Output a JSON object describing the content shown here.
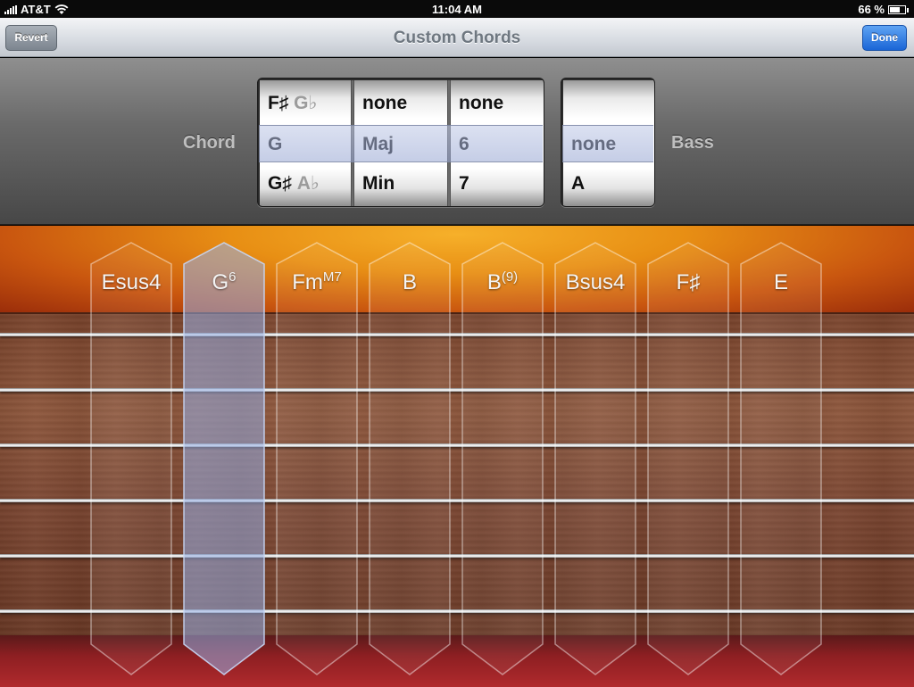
{
  "status_bar": {
    "carrier": "AT&T",
    "time": "11:04 AM",
    "battery_percent": "66 %",
    "battery_level": 0.66
  },
  "nav": {
    "title": "Custom Chords",
    "revert_label": "Revert",
    "done_label": "Done"
  },
  "picker": {
    "chord_label": "Chord",
    "bass_label": "Bass",
    "root_wheel": {
      "top": {
        "main": "F♯",
        "alt": "G♭"
      },
      "selected": {
        "main": "G",
        "alt": ""
      },
      "bottom": {
        "main": "G♯",
        "alt": "A♭"
      }
    },
    "quality_wheel": {
      "top": "none",
      "selected": "Maj",
      "bottom": "Min"
    },
    "extension_wheel": {
      "top": "none",
      "selected": "6",
      "bottom": "7"
    },
    "bass_wheel": {
      "top": "",
      "selected": "none",
      "bottom": "A"
    }
  },
  "chord_strips": [
    {
      "root": "Esus4",
      "sup": "",
      "selected": false
    },
    {
      "root": "G",
      "sup": "6",
      "selected": true
    },
    {
      "root": "Fm",
      "sup": "M7",
      "selected": false
    },
    {
      "root": "B",
      "sup": "",
      "selected": false
    },
    {
      "root": "B",
      "sup": "(9)",
      "selected": false
    },
    {
      "root": "Bsus4",
      "sup": "",
      "selected": false
    },
    {
      "root": "F♯",
      "sup": "",
      "selected": false
    },
    {
      "root": "E",
      "sup": "",
      "selected": false
    }
  ],
  "colors": {
    "done_button": "#2a78e4",
    "selected_strip": "#8fa7d6",
    "panel": "#5c5c5c"
  }
}
